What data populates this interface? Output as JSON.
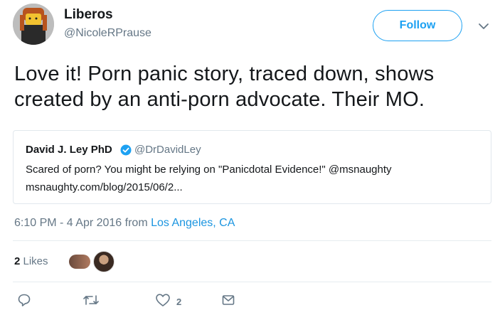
{
  "user": {
    "display_name": "Liberos",
    "handle": "@NicoleRPrause"
  },
  "follow_label": "Follow",
  "tweet": {
    "line1": "Love it! Porn panic story, traced down, shows",
    "line2": "created by an anti-porn advocate. Their MO."
  },
  "quote": {
    "name": "David J. Ley PhD",
    "handle": "@DrDavidLey",
    "text": "Scared of porn? You might be relying on \"Panicdotal Evidence!\" @msnaughty",
    "link": "msnaughty.com/blog/2015/06/2..."
  },
  "meta": {
    "time": "6:10 PM - 4 Apr 2016 from ",
    "location": "Los Angeles, CA"
  },
  "likes": {
    "count": "2",
    "label": " Likes"
  },
  "actions": {
    "like_count": "2"
  },
  "colors": {
    "accent": "#1da1f2",
    "link": "#1b95e0",
    "muted": "#657786"
  }
}
